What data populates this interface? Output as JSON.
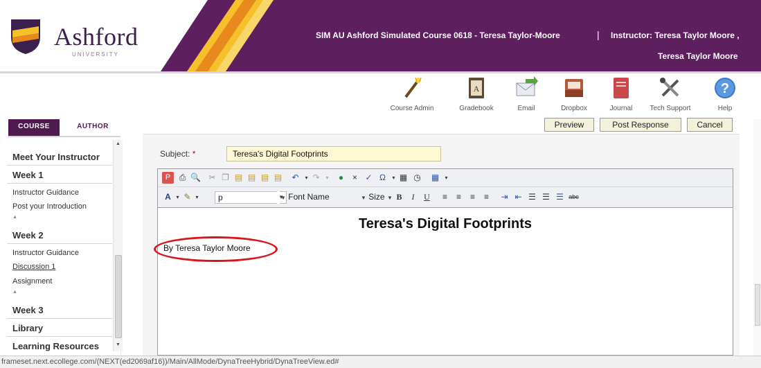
{
  "header": {
    "logo_text": "Ashford",
    "logo_subtext": "UNIVERSITY",
    "course_title": "SIM AU Ashford Simulated Course 0618 - Teresa Taylor-Moore",
    "separator": "|",
    "instructor_line1": "Instructor:  Teresa Taylor Moore ,",
    "instructor_line2": "Teresa Taylor Moore",
    "colors": {
      "purple": "#5e1f5e",
      "gold": "#f6c02a",
      "orange": "#e8891e"
    }
  },
  "tools": [
    {
      "label": "Course Admin",
      "icon": "wand-icon"
    },
    {
      "label": "Gradebook",
      "icon": "gradebook-icon"
    },
    {
      "label": "Email",
      "icon": "email-icon"
    },
    {
      "label": "Dropbox",
      "icon": "dropbox-icon"
    },
    {
      "label": "Journal",
      "icon": "journal-icon"
    },
    {
      "label": "Tech Support",
      "icon": "tools-icon"
    },
    {
      "label": "Help",
      "icon": "help-icon"
    }
  ],
  "tabs": {
    "course": "COURSE",
    "author": "AUTHOR"
  },
  "sidebar": {
    "meet_instructor": "Meet Your Instructor",
    "week1": "Week 1",
    "week1_guidance": "Instructor Guidance",
    "week1_intro": "Post your Introduction",
    "week2": "Week 2",
    "week2_guidance": "Instructor Guidance",
    "week2_discussion": "Discussion 1",
    "week2_assignment": "Assignment",
    "week3": "Week 3",
    "library": "Library",
    "learning_resources": "Learning Resources"
  },
  "actions": {
    "preview": "Preview",
    "post_response": "Post Response",
    "cancel": "Cancel"
  },
  "form": {
    "subject_label": "Subject:",
    "required_mark": "*",
    "subject_value": "Teresa's Digital Footprints"
  },
  "editor_toolbar": {
    "format_value": "p",
    "font_name": "Font Name",
    "size": "Size"
  },
  "document": {
    "title": "Teresa's Digital Footprints",
    "byline": "By Teresa Taylor Moore",
    "annotation_color": "#d9141c"
  },
  "status_bar": {
    "url": "frameset.next.ecollege.com/(NEXT(ed2069af16))/Main/AllMode/DynaTreeHybrid/DynaTreeView.ed#"
  }
}
